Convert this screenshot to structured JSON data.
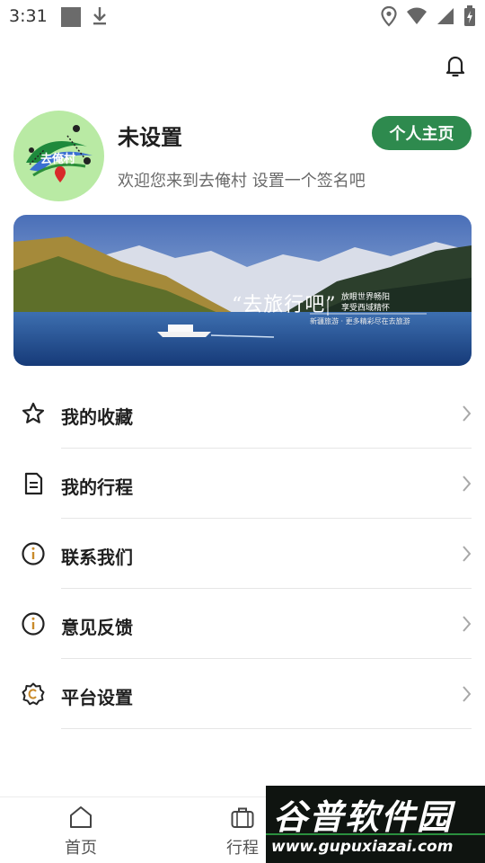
{
  "status_bar": {
    "time": "3:31"
  },
  "profile": {
    "nickname": "未设置",
    "signature": "欢迎您来到去俺村 设置一个签名吧",
    "home_button": "个人主页"
  },
  "banner": {
    "title": "“去旅行吧”",
    "subtitle_1": "放眼世界畅阳",
    "subtitle_2": "享受西域精怀",
    "subtitle_3": "新疆旅游 · 更多精彩尽在去旅游"
  },
  "menu": {
    "items": [
      {
        "label": "我的收藏",
        "icon": "star-icon"
      },
      {
        "label": "我的行程",
        "icon": "document-icon"
      },
      {
        "label": "联系我们",
        "icon": "info-icon"
      },
      {
        "label": "意见反馈",
        "icon": "info-icon"
      },
      {
        "label": "平台设置",
        "icon": "settings-icon"
      }
    ]
  },
  "tabs": [
    {
      "label": "首页",
      "icon": "home-icon"
    },
    {
      "label": "行程",
      "icon": "briefcase-icon"
    }
  ],
  "watermark": {
    "title": "谷普软件园",
    "url": "www.gupuxiazai.com"
  },
  "colors": {
    "accent": "#2e8a4e",
    "avatar_bg": "#b9eaa4"
  }
}
